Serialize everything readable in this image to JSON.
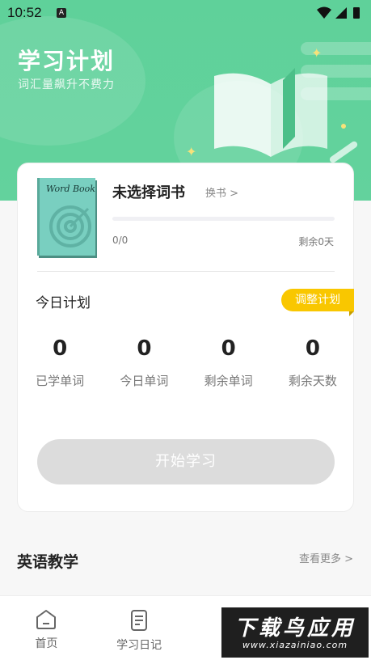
{
  "status_bar": {
    "time": "10:52",
    "notification_icon": "A"
  },
  "hero": {
    "title": "学习计划",
    "subtitle": "词汇量飙升不费力"
  },
  "book": {
    "cover_title": "Word Book",
    "name": "未选择词书",
    "change_label": "换书 >",
    "progress_text": "0/0",
    "remaining_text": "剩余0天",
    "progress_fraction": 0
  },
  "plan": {
    "title": "今日计划",
    "adjust_label": "调整计划",
    "stats": [
      {
        "value": "0",
        "label": "已学单词"
      },
      {
        "value": "0",
        "label": "今日单词"
      },
      {
        "value": "0",
        "label": "剩余单词"
      },
      {
        "value": "0",
        "label": "剩余天数"
      }
    ],
    "start_label": "开始学习"
  },
  "section": {
    "title": "英语教学",
    "more_label": "查看更多 >"
  },
  "tabs": [
    {
      "label": "首页",
      "icon": "home-icon"
    },
    {
      "label": "学习日记",
      "icon": "notebook-icon"
    }
  ],
  "watermark": {
    "main": "下载鸟应用",
    "url": "www.xiazainiao.com"
  },
  "colors": {
    "accent": "#5fd19a",
    "adjust": "#f9c700",
    "disabled_button": "#dcdcdc"
  }
}
